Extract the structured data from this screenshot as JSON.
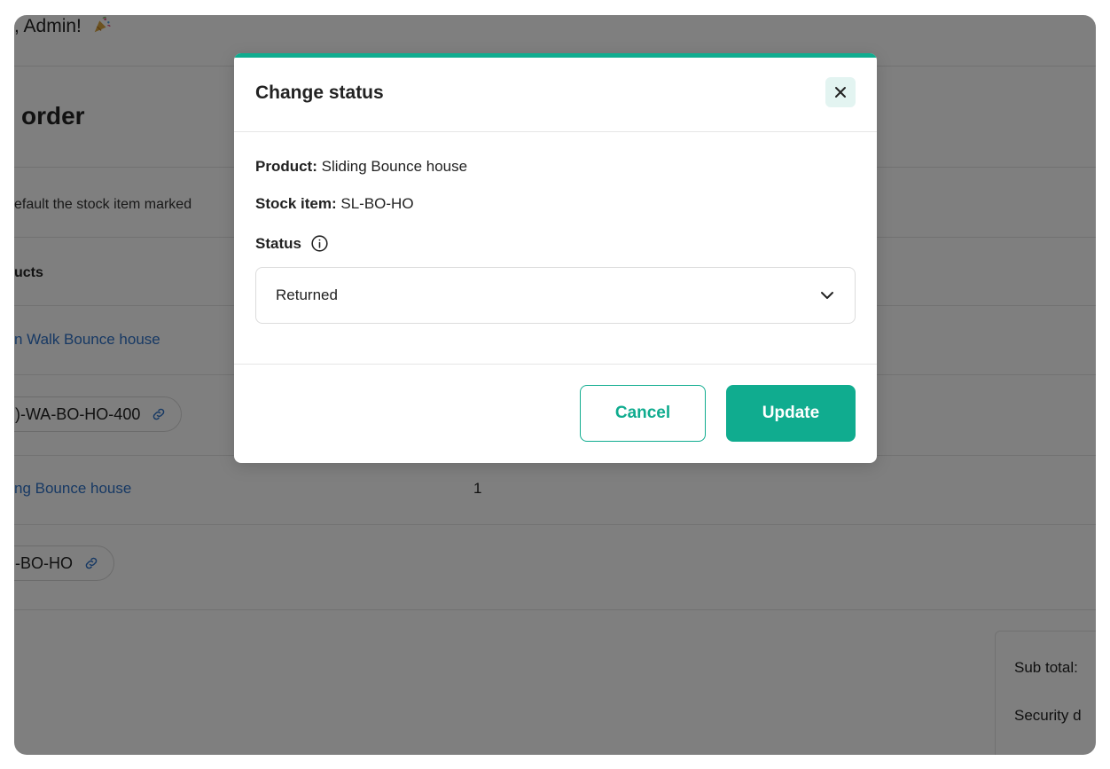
{
  "background": {
    "greeting": ", Admin!",
    "page_title": "order",
    "info_text": "efault the stock item marked",
    "products_header": "ucts",
    "product_1_link": "n Walk Bounce house",
    "product_1_sku": ")-WA-BO-HO-400",
    "product_2_link": "ng Bounce house",
    "product_2_qty": "1",
    "product_2_sku": "-BO-HO",
    "subtotal_label": "Sub total:",
    "security_label": "Security d"
  },
  "modal": {
    "title": "Change status",
    "product_label": "Product:",
    "product_value": "Sliding Bounce house",
    "stock_label": "Stock item:",
    "stock_value": "SL-BO-HO",
    "status_label": "Status",
    "status_selected": "Returned",
    "cancel_label": "Cancel",
    "update_label": "Update"
  },
  "colors": {
    "accent": "#10ac8f",
    "link": "#2f72c9",
    "overlay": "rgba(0,0,0,0.5)"
  },
  "icons": [
    "party-popper-icon",
    "link-icon",
    "close-icon",
    "info-icon",
    "chevron-down-icon"
  ]
}
